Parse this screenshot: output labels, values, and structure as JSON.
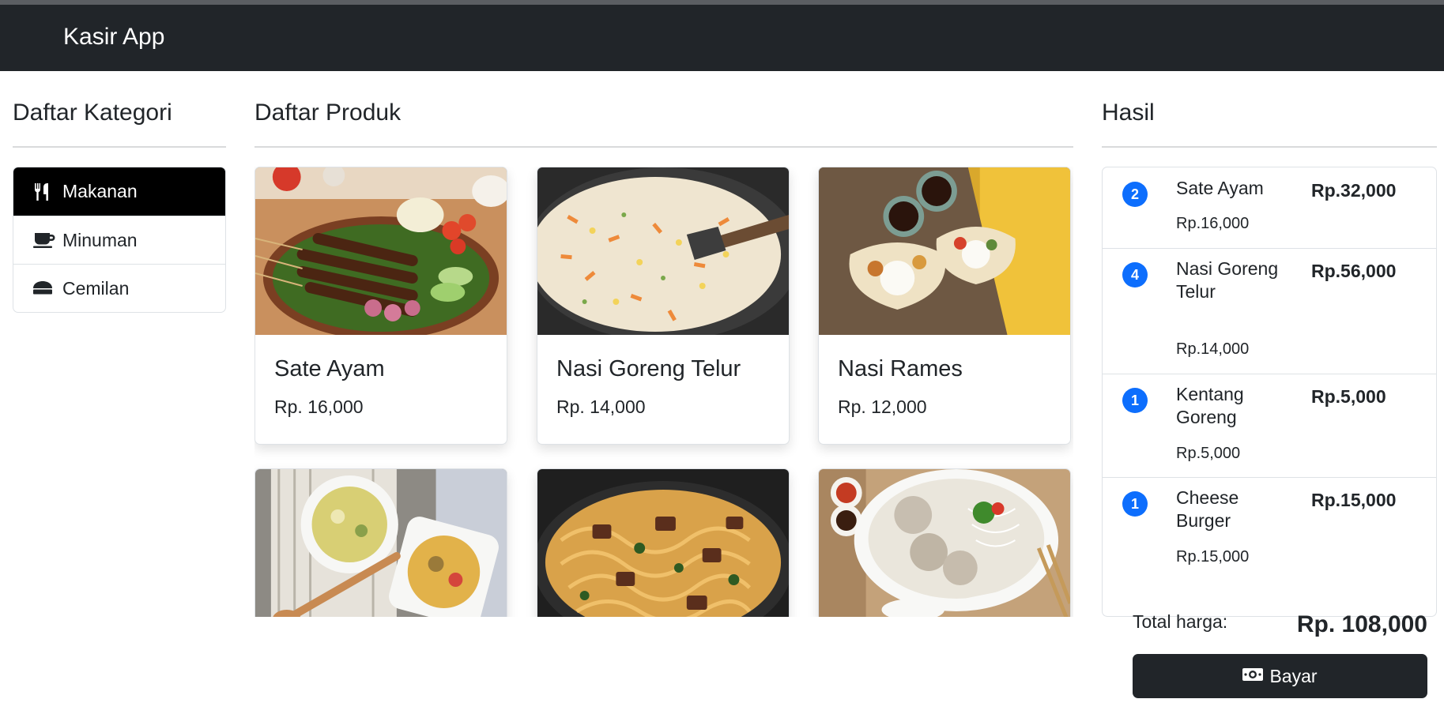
{
  "app": {
    "title": "Kasir App"
  },
  "categories": {
    "title": "Daftar Kategori",
    "items": [
      {
        "label": "Makanan",
        "icon": "utensils-icon",
        "active": true
      },
      {
        "label": "Minuman",
        "icon": "coffee-icon",
        "active": false
      },
      {
        "label": "Cemilan",
        "icon": "cheese-icon",
        "active": false
      }
    ]
  },
  "products": {
    "title": "Daftar Produk",
    "items": [
      {
        "name": "Sate Ayam",
        "price": "Rp. 16,000",
        "image": "sate-ayam-photo"
      },
      {
        "name": "Nasi Goreng Telur",
        "price": "Rp. 14,000",
        "image": "nasi-goreng-photo"
      },
      {
        "name": "Nasi Rames",
        "price": "Rp. 12,000",
        "image": "nasi-rames-photo"
      },
      {
        "name": "",
        "price": "",
        "image": "lontong-sayur-photo"
      },
      {
        "name": "",
        "price": "",
        "image": "mie-goreng-photo"
      },
      {
        "name": "",
        "price": "",
        "image": "bakso-photo"
      }
    ]
  },
  "hasil": {
    "title": "Hasil",
    "items": [
      {
        "qty": "2",
        "name": "Sate Ayam",
        "unit_price": "Rp.16,000",
        "total": "Rp.32,000"
      },
      {
        "qty": "4",
        "name": "Nasi Goreng Telur",
        "unit_price": "Rp.14,000",
        "total": "Rp.56,000"
      },
      {
        "qty": "1",
        "name": "Kentang Goreng",
        "unit_price": "Rp.5,000",
        "total": "Rp.5,000"
      },
      {
        "qty": "1",
        "name": "Cheese Burger",
        "unit_price": "Rp.15,000",
        "total": "Rp.15,000"
      }
    ],
    "total_label": "Total harga:",
    "total_value": "Rp. 108,000",
    "pay_label": "Bayar"
  },
  "colors": {
    "navbar": "#212529",
    "active_category": "#000000",
    "qty_badge": "#0d6efd",
    "pay_button": "#212529"
  }
}
